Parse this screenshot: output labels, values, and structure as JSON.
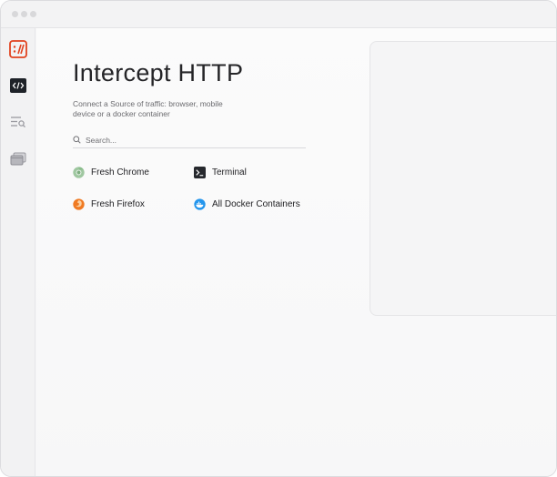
{
  "window": {
    "controls": [
      "close-dot",
      "minimize-dot",
      "maximize-dot"
    ]
  },
  "sidebar": {
    "items": [
      {
        "name": "app-logo",
        "icon": "httptoolkit-logo-icon",
        "color": "#e1421f"
      },
      {
        "name": "intercept",
        "icon": "code-brackets-icon",
        "active": true,
        "color": "#1e2228"
      },
      {
        "name": "view",
        "icon": "list-search-icon",
        "color": "#9a9aa0"
      },
      {
        "name": "mock",
        "icon": "stacked-windows-icon",
        "color": "#9a9aa0"
      }
    ]
  },
  "main": {
    "title": "Intercept HTTP",
    "subtitle": "Connect a Source of traffic: browser, mobile device or a docker container",
    "search": {
      "placeholder": "Search...",
      "value": ""
    },
    "sources": [
      {
        "label": "Fresh Chrome",
        "icon": "chrome-icon"
      },
      {
        "label": "Terminal",
        "icon": "terminal-icon"
      },
      {
        "label": "Fresh Firefox",
        "icon": "firefox-icon"
      },
      {
        "label": "All Docker Containers",
        "icon": "docker-icon"
      }
    ]
  }
}
